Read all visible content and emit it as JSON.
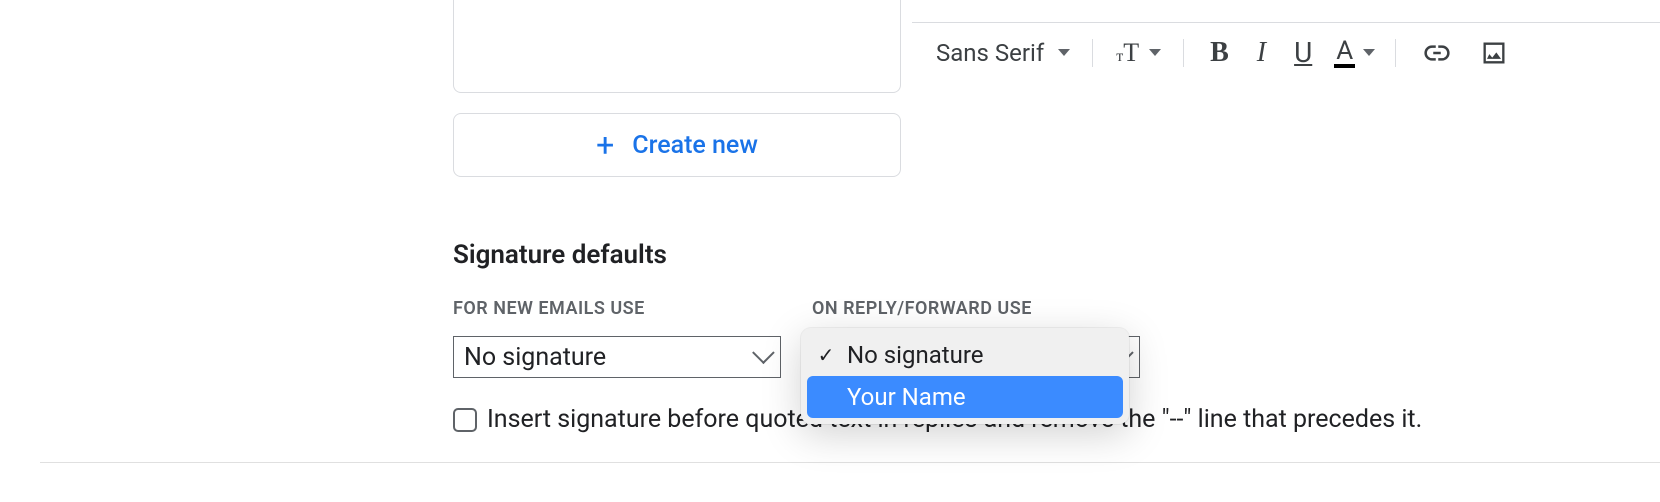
{
  "toolbar": {
    "font": "Sans Serif"
  },
  "create_new_label": "Create new",
  "section_heading": "Signature defaults",
  "labels": {
    "for_new": "FOR NEW EMAILS USE",
    "on_reply": "ON REPLY/FORWARD USE"
  },
  "defaults": {
    "for_new_value": "No signature"
  },
  "dropdown": {
    "options": [
      {
        "label": "No signature",
        "checked": true,
        "highlighted": false
      },
      {
        "label": "Your Name",
        "checked": false,
        "highlighted": true
      }
    ]
  },
  "insert_text": "Insert signature before quoted text in replies and remove the \"--\" line that precedes it."
}
